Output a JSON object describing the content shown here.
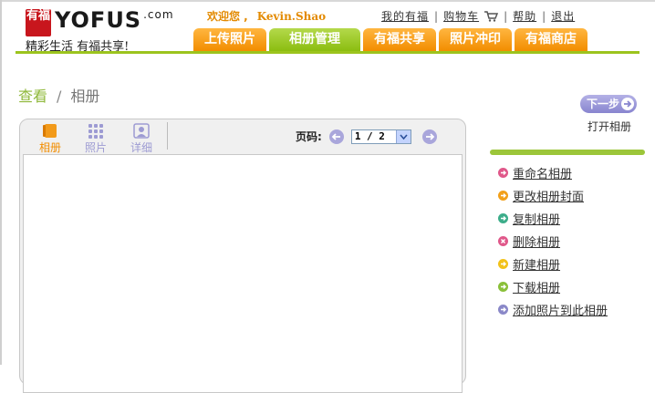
{
  "logo": {
    "seal_text": "有福",
    "brand": "YOFUS",
    "brand_suffix": ".com",
    "slogan": "精彩生活 有福共享!"
  },
  "header": {
    "welcome": "欢迎您 ,",
    "username": "Kevin.Shao",
    "links": {
      "my_account": "我的有福",
      "cart": "购物车",
      "help": "帮助",
      "logout": "退出"
    },
    "separator": "|"
  },
  "nav": {
    "tabs": [
      {
        "label": "上传照片",
        "active": false
      },
      {
        "label": "相册管理",
        "active": true
      },
      {
        "label": "有福共享",
        "active": false
      },
      {
        "label": "照片冲印",
        "active": false
      },
      {
        "label": "有福商店",
        "active": false
      }
    ]
  },
  "breadcrumb": {
    "parent": "查看",
    "separator": "/",
    "current": "相册"
  },
  "next_step": {
    "button_label": "下一步",
    "caption": "打开相册"
  },
  "viewer": {
    "view_modes": [
      {
        "label": "相册",
        "icon": "album-icon",
        "selected": true
      },
      {
        "label": "照片",
        "icon": "grid-icon",
        "selected": false
      },
      {
        "label": "详细",
        "icon": "detail-icon",
        "selected": false
      }
    ],
    "pager": {
      "label": "页码:",
      "current_page": "1",
      "separator": "/",
      "total_pages": "2",
      "display": "1 / 2"
    }
  },
  "actions": [
    {
      "label": "重命名相册",
      "color": "#e0588a",
      "icon": "arrow-icon"
    },
    {
      "label": "更改相册封面",
      "color": "#f2a01a",
      "icon": "arrow-icon"
    },
    {
      "label": "复制相册",
      "color": "#3dad8a",
      "icon": "arrow-icon"
    },
    {
      "label": "删除相册",
      "color": "#e0588a",
      "icon": "x-icon"
    },
    {
      "label": "新建相册",
      "color": "#f2c21a",
      "icon": "arrow-icon"
    },
    {
      "label": "下载相册",
      "color": "#8ac03a",
      "icon": "arrow-icon"
    },
    {
      "label": "添加照片到此相册",
      "color": "#8a88c8",
      "icon": "arrow-icon"
    }
  ],
  "colors": {
    "brand_orange": "#f28d00",
    "brand_green": "#9cc41e",
    "accent_purple": "#8885cf",
    "seal_red": "#c8161d"
  }
}
